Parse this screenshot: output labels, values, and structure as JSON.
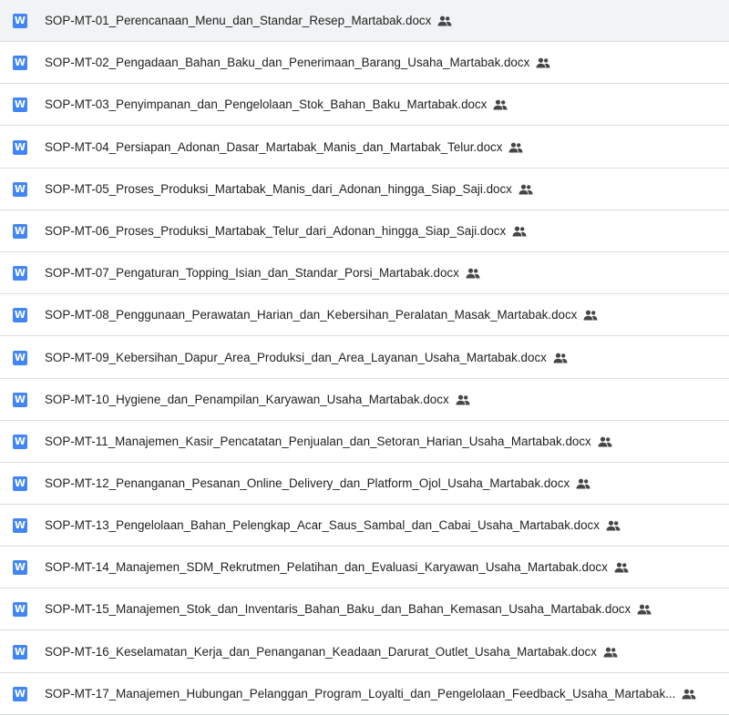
{
  "files": [
    {
      "name": "SOP-MT-01_Perencanaan_Menu_dan_Standar_Resep_Martabak.docx",
      "type_icon": "word-doc-icon",
      "type_icon_letter": "W",
      "shared_icon": "shared-people-icon"
    },
    {
      "name": "SOP-MT-02_Pengadaan_Bahan_Baku_dan_Penerimaan_Barang_Usaha_Martabak.docx",
      "type_icon": "word-doc-icon",
      "type_icon_letter": "W",
      "shared_icon": "shared-people-icon"
    },
    {
      "name": "SOP-MT-03_Penyimpanan_dan_Pengelolaan_Stok_Bahan_Baku_Martabak.docx",
      "type_icon": "word-doc-icon",
      "type_icon_letter": "W",
      "shared_icon": "shared-people-icon"
    },
    {
      "name": "SOP-MT-04_Persiapan_Adonan_Dasar_Martabak_Manis_dan_Martabak_Telur.docx",
      "type_icon": "word-doc-icon",
      "type_icon_letter": "W",
      "shared_icon": "shared-people-icon"
    },
    {
      "name": "SOP-MT-05_Proses_Produksi_Martabak_Manis_dari_Adonan_hingga_Siap_Saji.docx",
      "type_icon": "word-doc-icon",
      "type_icon_letter": "W",
      "shared_icon": "shared-people-icon"
    },
    {
      "name": "SOP-MT-06_Proses_Produksi_Martabak_Telur_dari_Adonan_hingga_Siap_Saji.docx",
      "type_icon": "word-doc-icon",
      "type_icon_letter": "W",
      "shared_icon": "shared-people-icon"
    },
    {
      "name": "SOP-MT-07_Pengaturan_Topping_Isian_dan_Standar_Porsi_Martabak.docx",
      "type_icon": "word-doc-icon",
      "type_icon_letter": "W",
      "shared_icon": "shared-people-icon"
    },
    {
      "name": "SOP-MT-08_Penggunaan_Perawatan_Harian_dan_Kebersihan_Peralatan_Masak_Martabak.docx",
      "type_icon": "word-doc-icon",
      "type_icon_letter": "W",
      "shared_icon": "shared-people-icon"
    },
    {
      "name": "SOP-MT-09_Kebersihan_Dapur_Area_Produksi_dan_Area_Layanan_Usaha_Martabak.docx",
      "type_icon": "word-doc-icon",
      "type_icon_letter": "W",
      "shared_icon": "shared-people-icon"
    },
    {
      "name": "SOP-MT-10_Hygiene_dan_Penampilan_Karyawan_Usaha_Martabak.docx",
      "type_icon": "word-doc-icon",
      "type_icon_letter": "W",
      "shared_icon": "shared-people-icon"
    },
    {
      "name": "SOP-MT-11_Manajemen_Kasir_Pencatatan_Penjualan_dan_Setoran_Harian_Usaha_Martabak.docx",
      "type_icon": "word-doc-icon",
      "type_icon_letter": "W",
      "shared_icon": "shared-people-icon"
    },
    {
      "name": "SOP-MT-12_Penanganan_Pesanan_Online_Delivery_dan_Platform_Ojol_Usaha_Martabak.docx",
      "type_icon": "word-doc-icon",
      "type_icon_letter": "W",
      "shared_icon": "shared-people-icon"
    },
    {
      "name": "SOP-MT-13_Pengelolaan_Bahan_Pelengkap_Acar_Saus_Sambal_dan_Cabai_Usaha_Martabak.docx",
      "type_icon": "word-doc-icon",
      "type_icon_letter": "W",
      "shared_icon": "shared-people-icon"
    },
    {
      "name": "SOP-MT-14_Manajemen_SDM_Rekrutmen_Pelatihan_dan_Evaluasi_Karyawan_Usaha_Martabak.docx",
      "type_icon": "word-doc-icon",
      "type_icon_letter": "W",
      "shared_icon": "shared-people-icon"
    },
    {
      "name": "SOP-MT-15_Manajemen_Stok_dan_Inventaris_Bahan_Baku_dan_Bahan_Kemasan_Usaha_Martabak.docx",
      "type_icon": "word-doc-icon",
      "type_icon_letter": "W",
      "shared_icon": "shared-people-icon"
    },
    {
      "name": "SOP-MT-16_Keselamatan_Kerja_dan_Penanganan_Keadaan_Darurat_Outlet_Usaha_Martabak.docx",
      "type_icon": "word-doc-icon",
      "type_icon_letter": "W",
      "shared_icon": "shared-people-icon"
    },
    {
      "name": "SOP-MT-17_Manajemen_Hubungan_Pelanggan_Program_Loyalti_dan_Pengelolaan_Feedback_Usaha_Martabak...",
      "type_icon": "word-doc-icon",
      "type_icon_letter": "W",
      "shared_icon": "shared-people-icon"
    }
  ],
  "colors": {
    "word_icon": "#4285f4",
    "text": "#1f1f1f",
    "shared_icon": "#444746",
    "divider": "#dadce0"
  }
}
